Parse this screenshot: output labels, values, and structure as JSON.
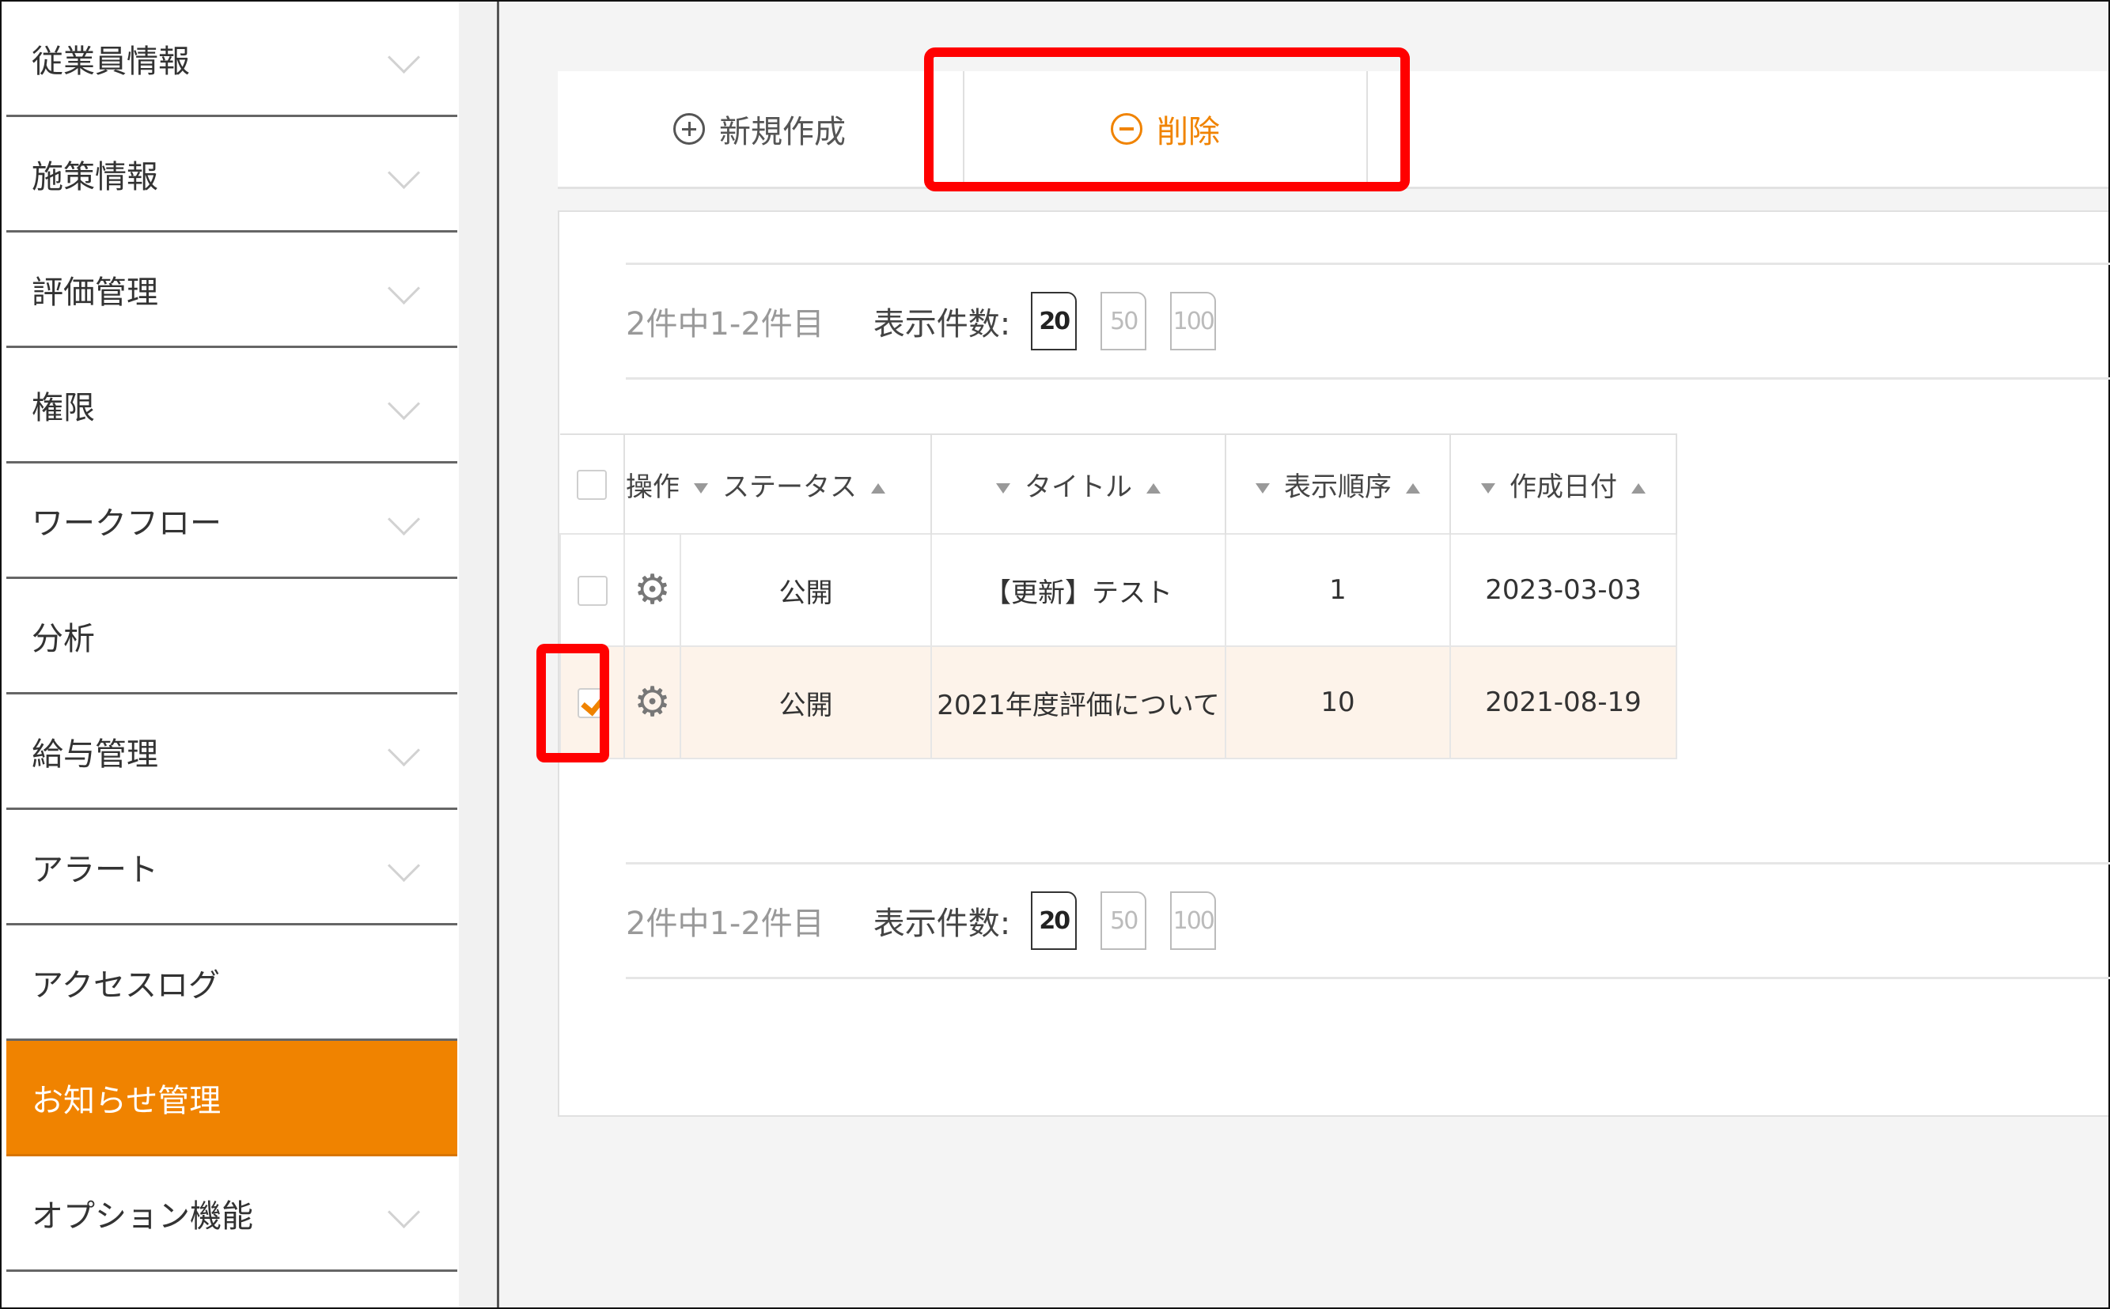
{
  "sidebar": {
    "items": [
      {
        "label": "従業員情報",
        "expandable": true,
        "active": false
      },
      {
        "label": "施策情報",
        "expandable": true,
        "active": false
      },
      {
        "label": "評価管理",
        "expandable": true,
        "active": false
      },
      {
        "label": "権限",
        "expandable": true,
        "active": false
      },
      {
        "label": "ワークフロー",
        "expandable": true,
        "active": false
      },
      {
        "label": "分析",
        "expandable": false,
        "active": false
      },
      {
        "label": "給与管理",
        "expandable": true,
        "active": false
      },
      {
        "label": "アラート",
        "expandable": true,
        "active": false
      },
      {
        "label": "アクセスログ",
        "expandable": false,
        "active": false
      },
      {
        "label": "お知らせ管理",
        "expandable": false,
        "active": true
      },
      {
        "label": "オプション機能",
        "expandable": true,
        "active": false
      }
    ],
    "accent_color": "#f08300"
  },
  "toolbar": {
    "new_label": "新規作成",
    "delete_label": "削除"
  },
  "pager": {
    "count_text": "2件中1-2件目",
    "per_page_label": "表示件数:",
    "options": [
      "20",
      "50",
      "100"
    ],
    "selected": "20"
  },
  "table": {
    "columns": [
      "操作",
      "ステータス",
      "タイトル",
      "表示順序",
      "作成日付"
    ],
    "rows": [
      {
        "status": "公開",
        "title": "【更新】テスト",
        "order": "1",
        "date": "2023-03-03",
        "checked": false
      },
      {
        "status": "公開",
        "title": "2021年度評価について",
        "order": "10",
        "date": "2021-08-19",
        "checked": true
      }
    ]
  },
  "highlight_color": "#ff0000"
}
